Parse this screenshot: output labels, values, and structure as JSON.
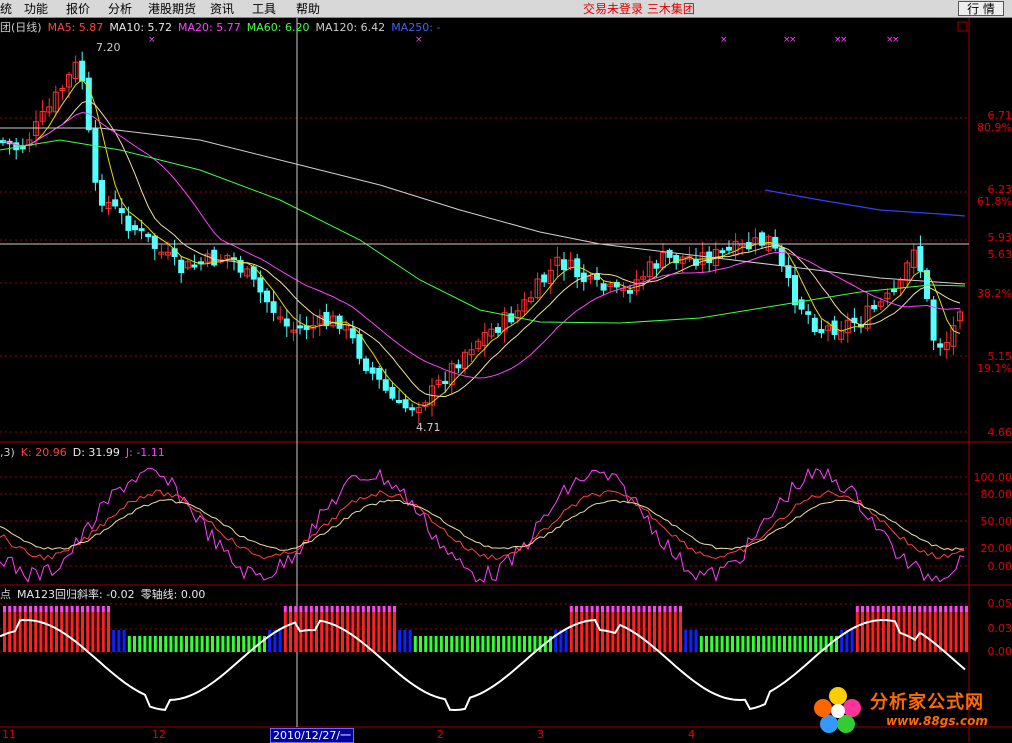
{
  "menu": {
    "items": [
      "统",
      "功能",
      "报价",
      "分析",
      "港股期货",
      "资讯",
      "工具",
      "帮助"
    ]
  },
  "status_text": "交易未登录 三木集团",
  "mode_button": "行 情",
  "main_panel": {
    "title": "团(日线)",
    "legend": [
      {
        "label": "MA5: 5.87",
        "color": "#ff4040"
      },
      {
        "label": "MA10: 5.72",
        "color": "#e8e8e8"
      },
      {
        "label": "MA20: 5.77",
        "color": "#ff40ff"
      },
      {
        "label": "MA60: 6.20",
        "color": "#40ff40"
      },
      {
        "label": "MA120: 6.42",
        "color": "#cccccc"
      },
      {
        "label": "MA250: -",
        "color": "#4040ff"
      }
    ],
    "high_annotation": "7.20",
    "low_annotation": "4.71",
    "price_labels": [
      "6.71",
      "6.23",
      "5.93",
      "5.63",
      "5.15",
      "4.66"
    ],
    "pct_labels": [
      "80.9%",
      "61.8%",
      "38.2%",
      "19.1%"
    ]
  },
  "kdj_panel": {
    "title": ",3)",
    "legend": [
      {
        "label": "K: 20.96",
        "color": "#ff4040"
      },
      {
        "label": "D: 31.99",
        "color": "#e8e8e8"
      },
      {
        "label": "J: -1.11",
        "color": "#ff40ff"
      }
    ],
    "axis_labels": [
      "100.00",
      "80.00",
      "50.00",
      "20.00",
      "0.00"
    ]
  },
  "ma_panel": {
    "title": "点",
    "legend": [
      {
        "label": "MA123回归斜率: -0.02",
        "color": "#e8e8e8"
      },
      {
        "label": "零轴线: 0.00",
        "color": "#e8e8e8"
      }
    ],
    "axis_labels": [
      "0.05",
      "0.03",
      "0.00"
    ]
  },
  "x_axis": {
    "labels": [
      "11",
      "12",
      "2",
      "3",
      "4"
    ],
    "cursor_date": "2010/12/27/一"
  },
  "watermark": {
    "title": "分析家公式网",
    "url": "www.88gs.com"
  },
  "colors": {
    "up": "#ff3030",
    "down": "#54ffff",
    "grid": "#a00000"
  }
}
